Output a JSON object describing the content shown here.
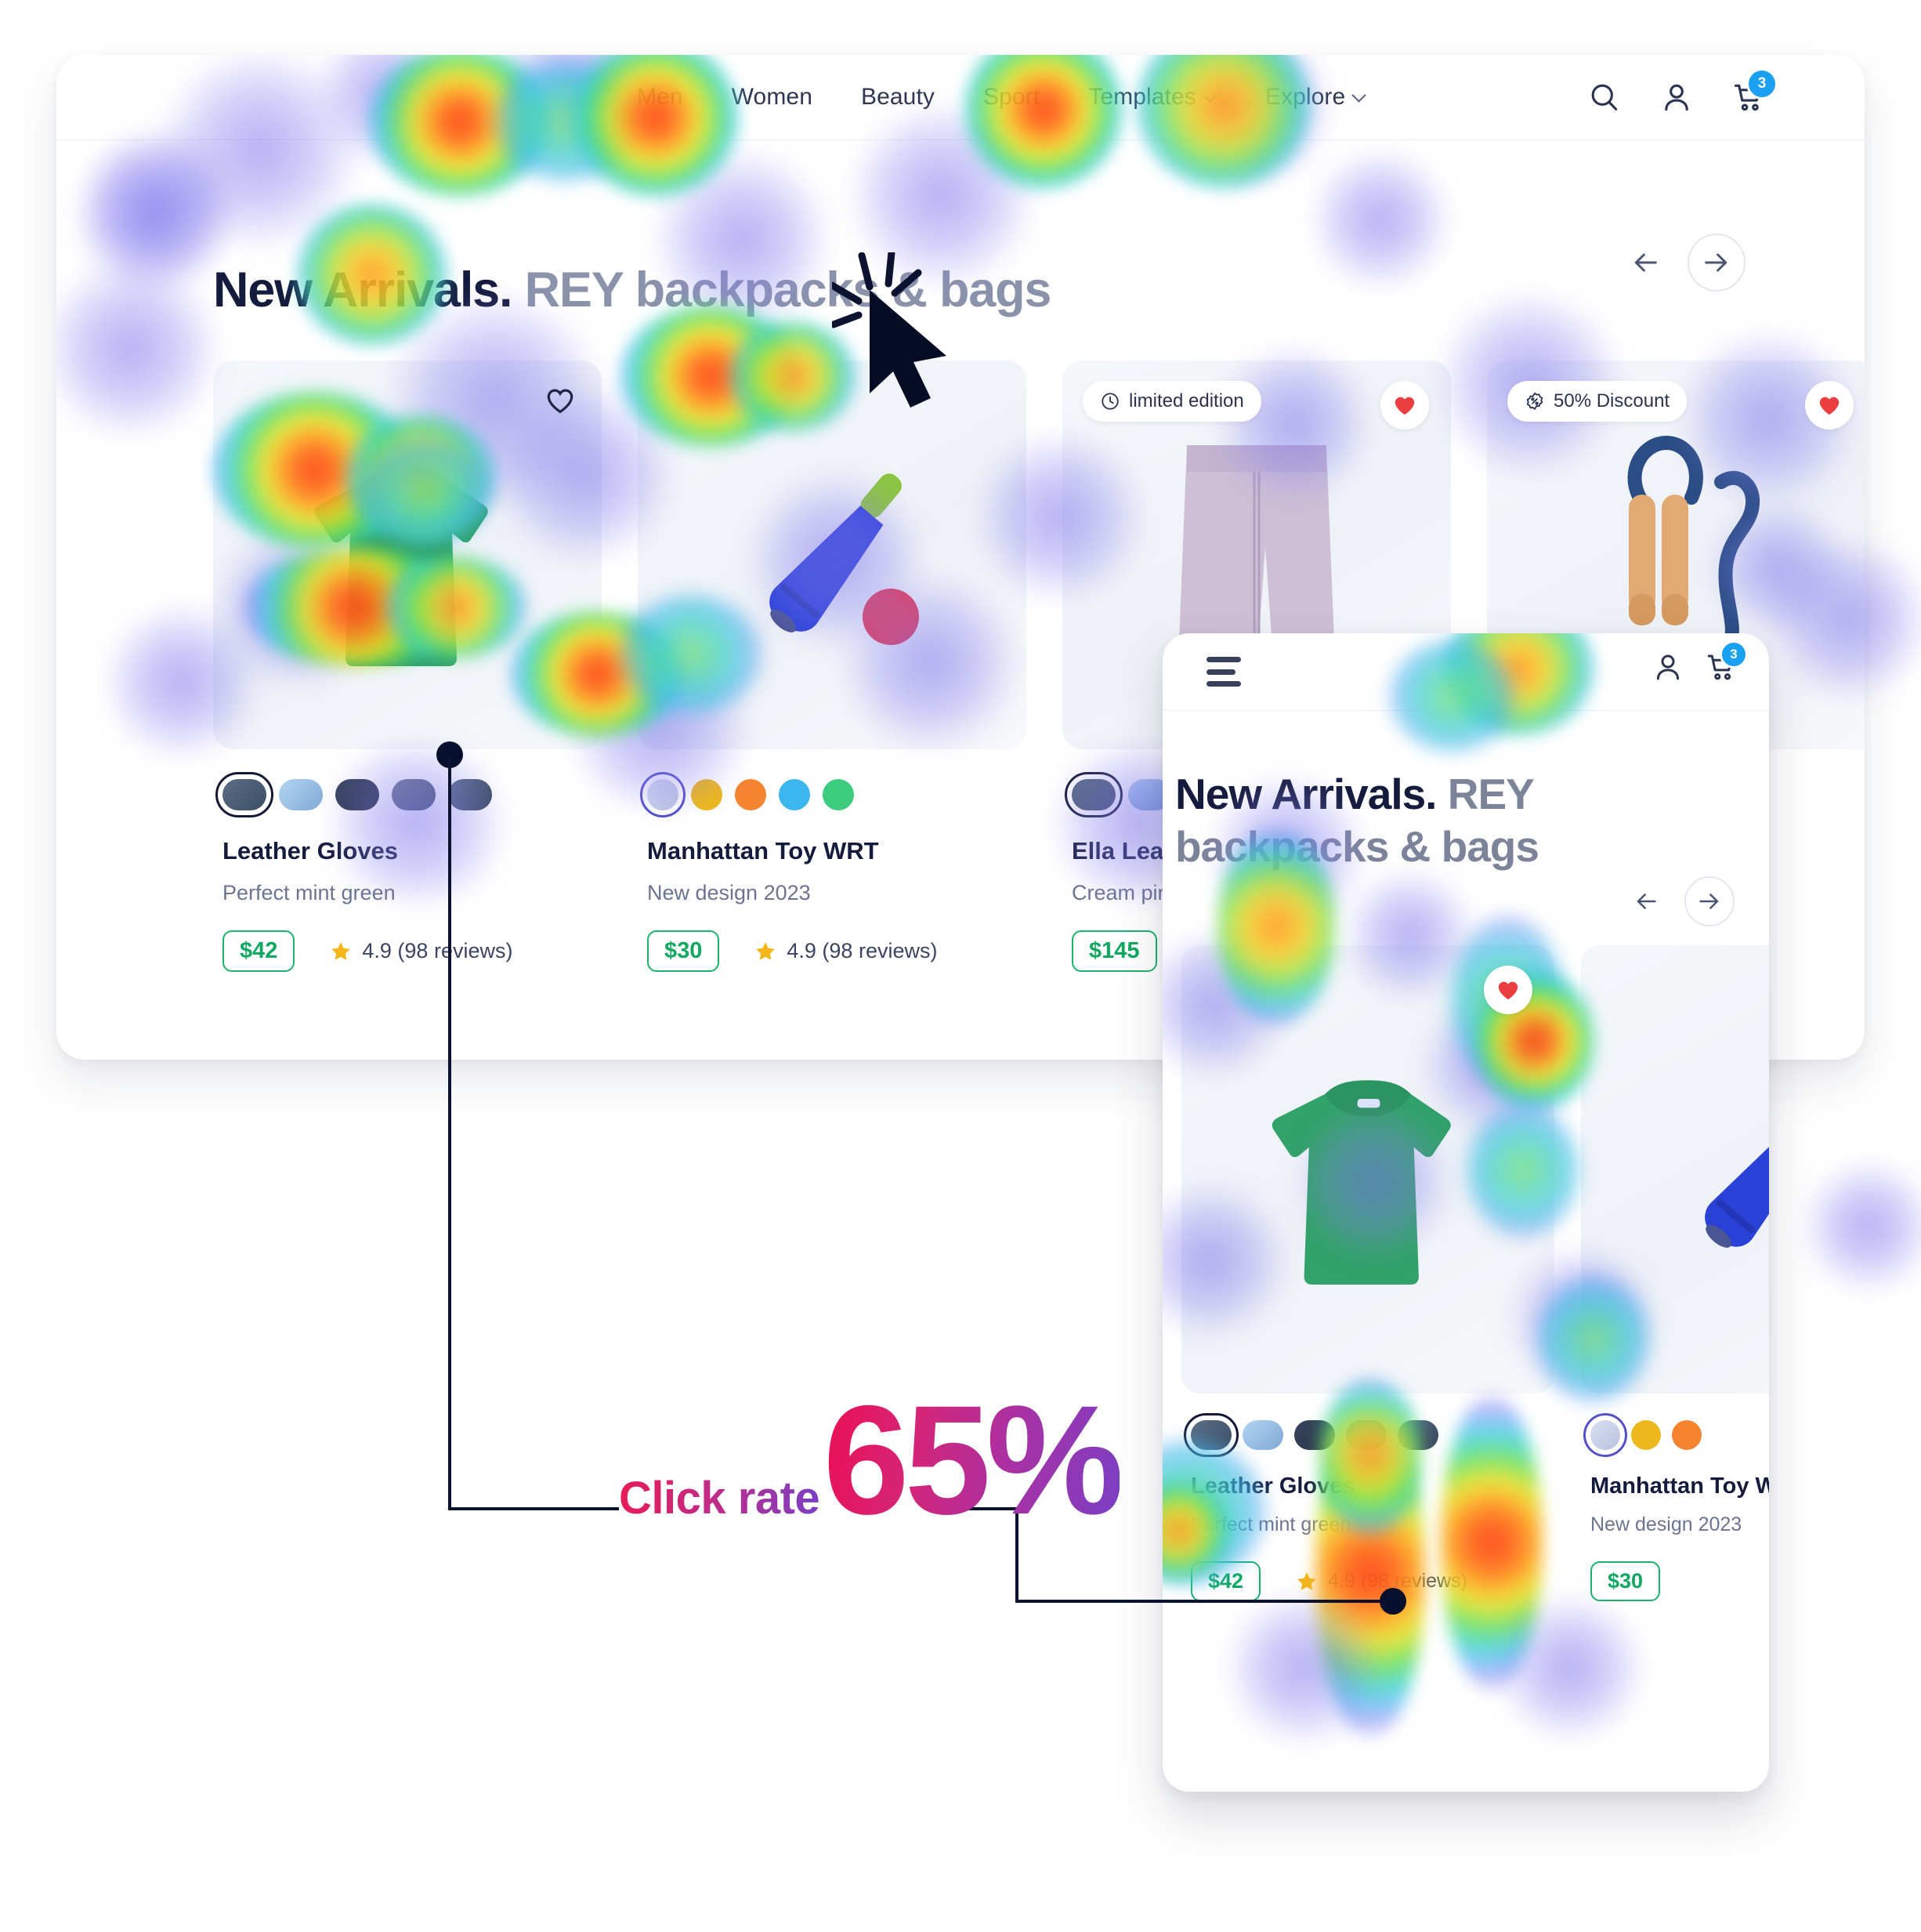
{
  "desktop": {
    "nav": [
      {
        "label": "Men",
        "caret": false
      },
      {
        "label": "Women",
        "caret": false
      },
      {
        "label": "Beauty",
        "caret": false
      },
      {
        "label": "Sport",
        "caret": false
      },
      {
        "label": "Templates",
        "caret": true
      },
      {
        "label": "Explore",
        "caret": true
      }
    ],
    "icons": {
      "search": "search-icon",
      "account": "user-icon",
      "cart": "cart-icon"
    },
    "cart_count": "3",
    "title": {
      "strong": "New Arrivals.",
      "muted": "REY backpacks & bags"
    },
    "nav_prev": "←",
    "nav_next": "→",
    "products": [
      {
        "name": "Leather Gloves",
        "desc": "Perfect mint green",
        "price": "$42",
        "rating": "4.9 (98 reviews)",
        "badge": null,
        "fav": "outline",
        "swatch_shape": "pill",
        "swatches": [
          "#4a5c72",
          "#9dc2e8",
          "#2e3b54",
          "#5a6c80",
          "#47566c"
        ],
        "selected_swatch": 0
      },
      {
        "name": "Manhattan Toy WRT",
        "desc": "New design 2023",
        "price": "$30",
        "rating": "4.9 (98 reviews)",
        "badge": null,
        "fav": null,
        "swatch_shape": "dot",
        "swatches": [
          "#cbd0e6",
          "#ecb81c",
          "#f58431",
          "#3cb6ef",
          "#3dcc7e"
        ],
        "selected_swatch": 0
      },
      {
        "name": "Ella Leather Tote",
        "desc": "Cream pink",
        "price": "$145",
        "rating": "",
        "badge": {
          "icon": "clock-icon",
          "label": "limited edition"
        },
        "fav": "filled",
        "swatch_shape": "pill",
        "swatches": [
          "#4a5c72",
          "#9dc2e8",
          "#2e3b54",
          "#5a6c80"
        ],
        "selected_swatch": 0
      },
      {
        "name": "",
        "desc": "",
        "price": "",
        "rating": "",
        "badge": {
          "icon": "discount-icon",
          "label": "50% Discount"
        },
        "fav": "filled",
        "swatch_shape": "pill",
        "swatches": [],
        "selected_swatch": -1
      }
    ]
  },
  "mobile": {
    "menu_icon": "hamburger-icon",
    "icons": {
      "account": "user-icon",
      "cart": "cart-icon"
    },
    "cart_count": "3",
    "title": {
      "strong": "New Arrivals.",
      "muted": "REY backpacks & bags"
    },
    "nav_prev": "←",
    "nav_next": "→",
    "products": [
      {
        "name": "Leather Gloves",
        "desc": "Perfect mint green",
        "price": "$42",
        "rating": "4.9 (98 reviews)",
        "fav": "filled",
        "swatch_shape": "pill",
        "swatches": [
          "#4a5c72",
          "#9dc2e8",
          "#2e3b54",
          "#6e7680",
          "#47566c"
        ],
        "selected_swatch": 0
      },
      {
        "name": "Manhattan Toy WRT",
        "desc": "New design 2023",
        "price": "$30",
        "rating": "",
        "fav": null,
        "swatch_shape": "dot",
        "swatches": [
          "#cbd0e6",
          "#ecb81c",
          "#f58431"
        ],
        "selected_swatch": 0
      }
    ]
  },
  "callout": {
    "label": "Click rate",
    "value": "65%",
    "gradient_start": "#ec0f53",
    "gradient_end": "#7a3fc4"
  },
  "cursor": {
    "name": "click-cursor"
  },
  "colors": {
    "accent_blue": "#1aa0f0",
    "price_green": "#10a861",
    "heart_red": "#ec3e3e",
    "star_yellow": "#f4b619",
    "title_dark": "#141b3d",
    "title_muted": "#8a93aa"
  }
}
